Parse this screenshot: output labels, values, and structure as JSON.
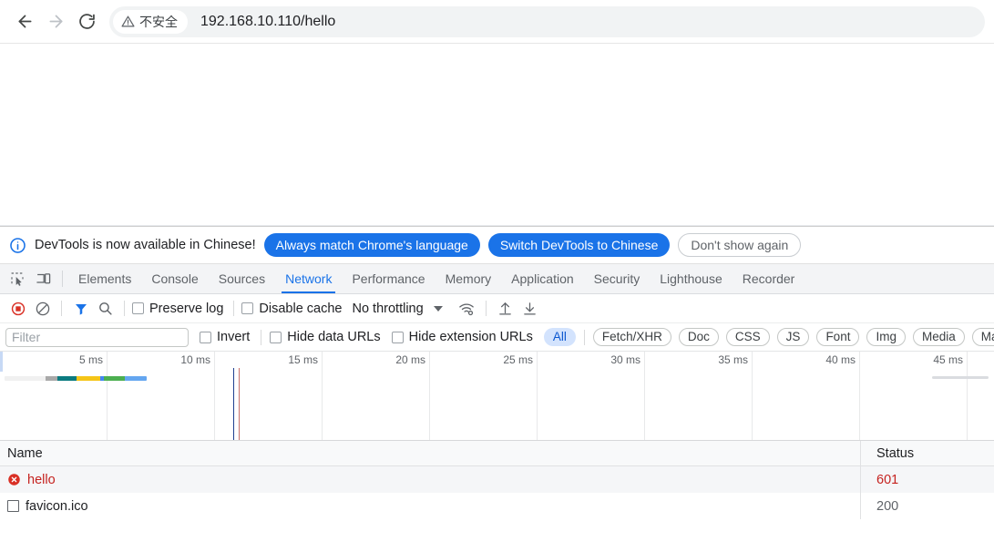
{
  "browser": {
    "back_label": "back-arrow",
    "forward_label": "forward-arrow",
    "reload_label": "reload",
    "security_text": "不安全",
    "url": "192.168.10.110/hello"
  },
  "devtools": {
    "infobar": {
      "message": "DevTools is now available in Chinese!",
      "primary_button": "Always match Chrome's language",
      "secondary_button": "Switch DevTools to Chinese",
      "dismiss_button": "Don't show again"
    },
    "tabs": [
      {
        "label": "Elements",
        "active": false
      },
      {
        "label": "Console",
        "active": false
      },
      {
        "label": "Sources",
        "active": false
      },
      {
        "label": "Network",
        "active": true
      },
      {
        "label": "Performance",
        "active": false
      },
      {
        "label": "Memory",
        "active": false
      },
      {
        "label": "Application",
        "active": false
      },
      {
        "label": "Security",
        "active": false
      },
      {
        "label": "Lighthouse",
        "active": false
      },
      {
        "label": "Recorder",
        "active": false
      }
    ],
    "network_toolbar": {
      "record_icon": "record-stop-icon",
      "clear_icon": "clear-icon",
      "filter_icon": "filter-funnel-icon",
      "search_icon": "search-icon",
      "preserve_log_label": "Preserve log",
      "preserve_log_checked": false,
      "disable_cache_label": "Disable cache",
      "disable_cache_checked": false,
      "throttling_value": "No throttling",
      "network_conditions_icon": "wifi-settings-icon",
      "import_icon": "import-har-icon",
      "export_icon": "export-har-icon"
    },
    "filter_row": {
      "filter_placeholder": "Filter",
      "filter_value": "",
      "invert_label": "Invert",
      "invert_checked": false,
      "hide_data_urls_label": "Hide data URLs",
      "hide_data_urls_checked": false,
      "hide_extension_urls_label": "Hide extension URLs",
      "hide_extension_urls_checked": false,
      "type_chips": [
        {
          "label": "All",
          "selected": true
        },
        {
          "label": "Fetch/XHR",
          "selected": false
        },
        {
          "label": "Doc",
          "selected": false
        },
        {
          "label": "CSS",
          "selected": false
        },
        {
          "label": "JS",
          "selected": false
        },
        {
          "label": "Font",
          "selected": false
        },
        {
          "label": "Img",
          "selected": false
        },
        {
          "label": "Media",
          "selected": false
        },
        {
          "label": "Ma",
          "selected": false
        }
      ]
    },
    "overview": {
      "ticks": [
        "5 ms",
        "10 ms",
        "15 ms",
        "20 ms",
        "25 ms",
        "30 ms",
        "35 ms",
        "40 ms",
        "45 ms"
      ],
      "waterfall_segments": [
        {
          "color": "#f0f0f0",
          "width": 45
        },
        {
          "color": "#a9a9a9",
          "width": 13
        },
        {
          "color": "#0b7b80",
          "width": 21
        },
        {
          "color": "#f5c518",
          "width": 26
        },
        {
          "color": "#4285f4",
          "width": 4
        },
        {
          "color": "#4caf50",
          "width": 23
        },
        {
          "color": "#64a6f0",
          "width": 24
        }
      ],
      "event_lines": [
        {
          "name": "dom-content-loaded",
          "color": "#1f3f8f"
        },
        {
          "name": "load",
          "color": "#c9706b"
        }
      ]
    },
    "requests": {
      "columns": [
        "Name",
        "Status"
      ],
      "rows": [
        {
          "name": "hello",
          "status": "601",
          "icon": "error-icon",
          "error": true
        },
        {
          "name": "favicon.ico",
          "status": "200",
          "icon": "document-icon",
          "error": false
        }
      ]
    }
  }
}
